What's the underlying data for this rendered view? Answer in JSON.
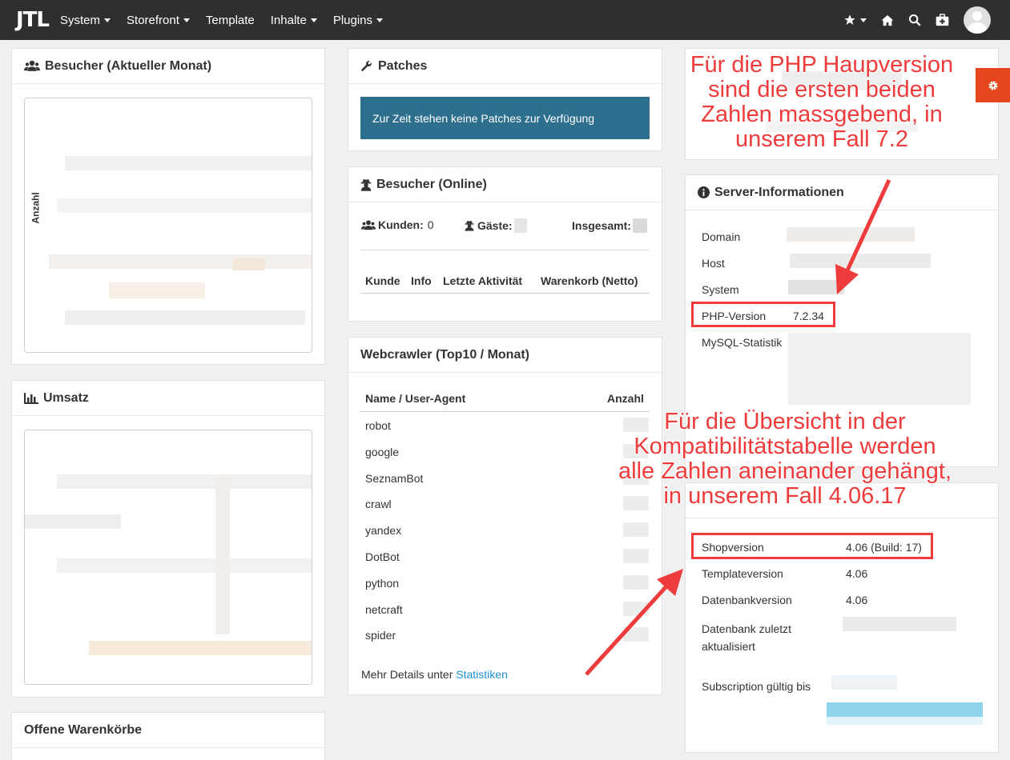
{
  "nav": {
    "logo": "JTL",
    "menu": [
      {
        "label": "System",
        "dropdown": true
      },
      {
        "label": "Storefront",
        "dropdown": true
      },
      {
        "label": "Template",
        "dropdown": false
      },
      {
        "label": "Inhalte",
        "dropdown": true
      },
      {
        "label": "Plugins",
        "dropdown": true
      }
    ],
    "icons": [
      "star-icon",
      "home-icon",
      "search-icon",
      "first-aid-icon",
      "avatar"
    ]
  },
  "visitors_month": {
    "title": "Besucher (Aktueller Monat)",
    "ylabel": "Anzahl"
  },
  "revenue": {
    "title": "Umsatz"
  },
  "open_carts": {
    "title": "Offene Warenkörbe"
  },
  "patches": {
    "title": "Patches",
    "message": "Zur Zeit stehen keine Patches zur Verfügung"
  },
  "visitors_online": {
    "title": "Besucher (Online)",
    "customers_label": "Kunden:",
    "customers_value": "0",
    "guests_label": "Gäste:",
    "total_label": "Insgesamt:",
    "columns": [
      "Kunde",
      "Info",
      "Letzte Aktivität",
      "Warenkorb (Netto)"
    ]
  },
  "webcrawler": {
    "title": "Webcrawler (Top10 / Monat)",
    "col_name": "Name / User-Agent",
    "col_count": "Anzahl",
    "rows": [
      "robot",
      "google",
      "SeznamBot",
      "crawl",
      "yandex",
      "DotBot",
      "python",
      "netcraft",
      "spider"
    ],
    "more_prefix": "Mehr Details unter",
    "more_link": "Statistiken"
  },
  "server_info": {
    "title": "Server-Informationen",
    "domain_label": "Domain",
    "host_label": "Host",
    "system_label": "System",
    "php_label": "PHP-Version",
    "php_value": "7.2.34",
    "mysql_label": "MySQL-Statistik"
  },
  "shop_info": {
    "shopversion_label": "Shopversion",
    "shopversion_value": "4.06 (Build: 17)",
    "templateversion_label": "Templateversion",
    "templateversion_value": "4.06",
    "dbversion_label": "Datenbankversion",
    "dbversion_value": "4.06",
    "dbupdated_label_1": "Datenbank zuletzt",
    "dbupdated_label_2": "aktualisiert",
    "subscription_label": "Subscription gültig bis"
  },
  "annotations": {
    "php_note": [
      "Für die PHP Haupversion",
      "sind die ersten beiden",
      "Zahlen massgebend, in",
      "unserem Fall 7.2"
    ],
    "compat_note": [
      "Für die Übersicht in der",
      "Kompatibilitätstabelle werden",
      "alle Zahlen aneinander gehängt,",
      "in unserem Fall 4.06.17"
    ],
    "color": "#ee3b3b"
  },
  "colors": {
    "nav_bg": "#2f2f2f",
    "alert_bg": "#2e6f8e",
    "gear_tab": "#e5461c",
    "link": "#1e90d0"
  }
}
